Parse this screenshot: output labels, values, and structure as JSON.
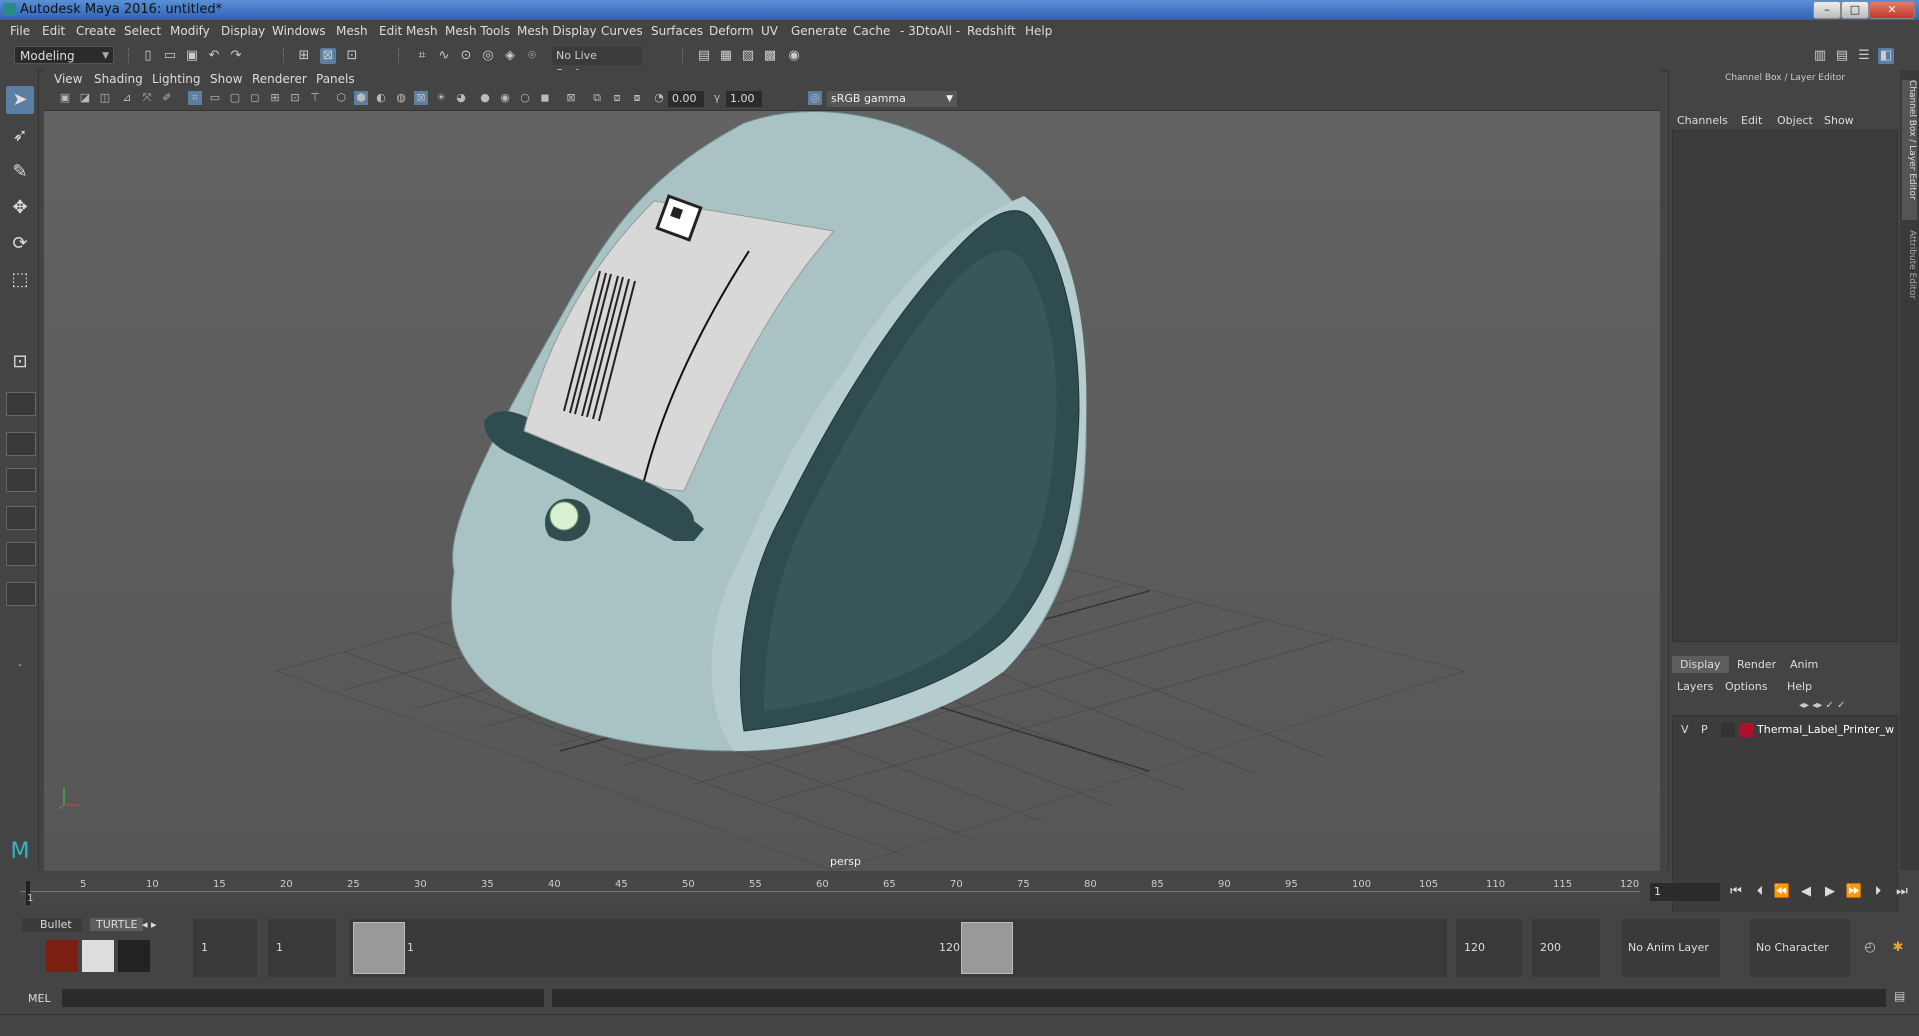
{
  "window": {
    "title": "Autodesk Maya 2016: untitled*",
    "min": "–",
    "max": "□",
    "close": "✕"
  },
  "menubar": [
    "File",
    "Edit",
    "Create",
    "Select",
    "Modify",
    "Display",
    "Windows",
    "Mesh",
    "Edit Mesh",
    "Mesh Tools",
    "Mesh Display",
    "Curves",
    "Surfaces",
    "Deform",
    "UV",
    "Generate",
    "Cache",
    "- 3DtoAll -",
    "Redshift",
    "Help"
  ],
  "statusline": {
    "mode": "Modeling",
    "live_surface": "No Live Surface"
  },
  "viewport": {
    "menu": [
      "View",
      "Shading",
      "Lighting",
      "Show",
      "Renderer",
      "Panels"
    ],
    "exposure": "0.00",
    "gamma": "1.00",
    "color_space": "sRGB gamma",
    "camera": "persp"
  },
  "right_panel": {
    "header": "Channel Box / Layer Editor",
    "menu": [
      "Channels",
      "Edit",
      "Object",
      "Show"
    ],
    "tabs": [
      "Display",
      "Render",
      "Anim"
    ],
    "layer_menu": [
      "Layers",
      "Options",
      "Help"
    ],
    "layer": {
      "v": "V",
      "p": "P",
      "name": "Thermal_Label_Printer_w",
      "color": "#b0102a"
    },
    "side_tabs": [
      "Channel Box / Layer Editor",
      "Attribute Editor"
    ]
  },
  "timeline": {
    "ticks": [
      "1",
      "5",
      "10",
      "15",
      "20",
      "25",
      "30",
      "35",
      "40",
      "45",
      "50",
      "55",
      "60",
      "65",
      "70",
      "75",
      "80",
      "85",
      "90",
      "95",
      "100",
      "105",
      "110",
      "115",
      "120"
    ],
    "current_frame": "1"
  },
  "range": {
    "shelf_tabs": [
      "Bullet",
      "TURTLE"
    ],
    "start": "1",
    "playback_start": "1",
    "handle_start": "1",
    "handle_end": "120",
    "playback_end": "120",
    "end": "200",
    "anim_layer": "No Anim Layer",
    "character_set": "No Character Set"
  },
  "command": {
    "label": "MEL"
  },
  "label": {
    "barcode_note": "QR"
  }
}
